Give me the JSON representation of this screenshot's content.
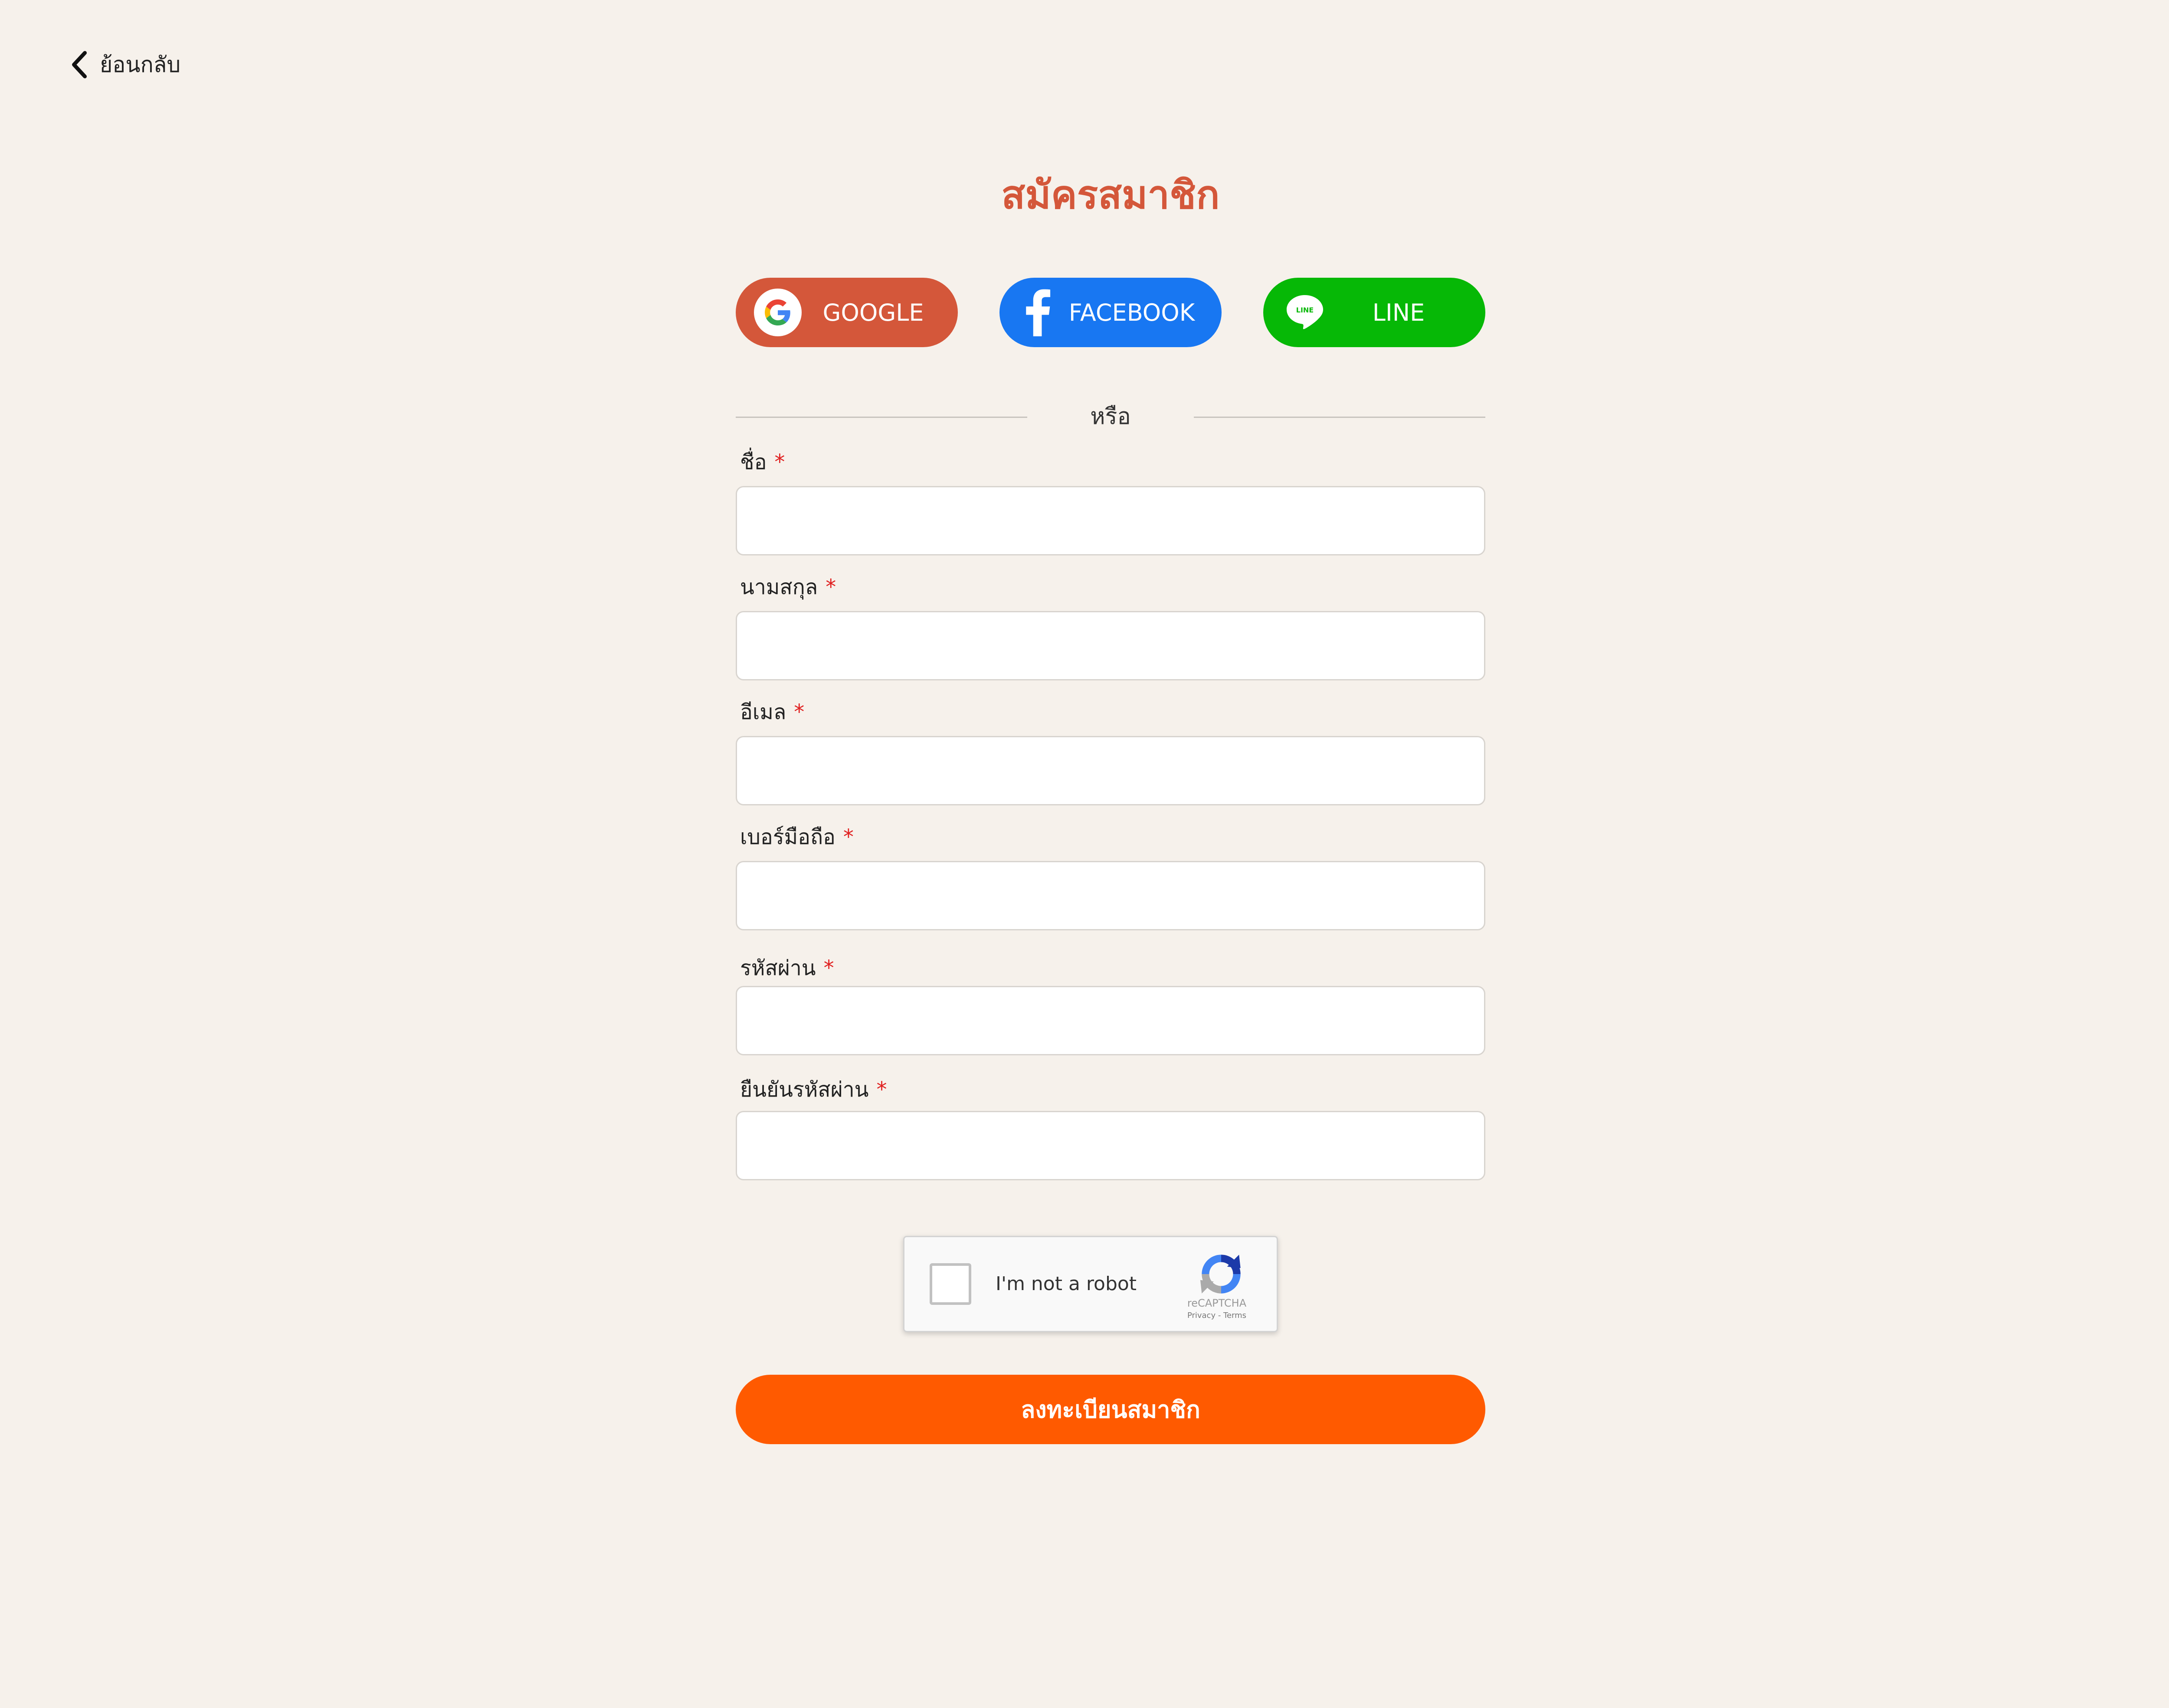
{
  "nav": {
    "back_label": "ย้อนกลับ"
  },
  "page": {
    "title": "สมัครสมาชิก"
  },
  "social": {
    "google_label": "GOOGLE",
    "facebook_label": "FACEBOOK",
    "line_label": "LINE",
    "line_badge": "LINE"
  },
  "divider": {
    "or_text": "หรือ"
  },
  "form": {
    "required_mark": "*",
    "fields": [
      {
        "label": "ชื่อ",
        "value": "",
        "type": "text"
      },
      {
        "label": "นามสกุล",
        "value": "",
        "type": "text"
      },
      {
        "label": "อีเมล",
        "value": "",
        "type": "email"
      },
      {
        "label": "เบอร์มือถือ",
        "value": "",
        "type": "tel"
      },
      {
        "label": "รหัสผ่าน",
        "value": "",
        "type": "password"
      },
      {
        "label": "ยืนยันรหัสผ่าน",
        "value": "",
        "type": "password"
      }
    ],
    "submit_label": "ลงทะเบียนสมาชิก"
  },
  "captcha": {
    "label": "I'm not a robot",
    "brand": "reCAPTCHA",
    "links": "Privacy - Terms",
    "checked": false
  },
  "colors": {
    "background": "#f6f1eb",
    "title": "#d4573a",
    "google": "#d4573a",
    "facebook": "#1877f2",
    "line": "#06b806",
    "submit": "#ff5a00",
    "required": "#e02020"
  }
}
